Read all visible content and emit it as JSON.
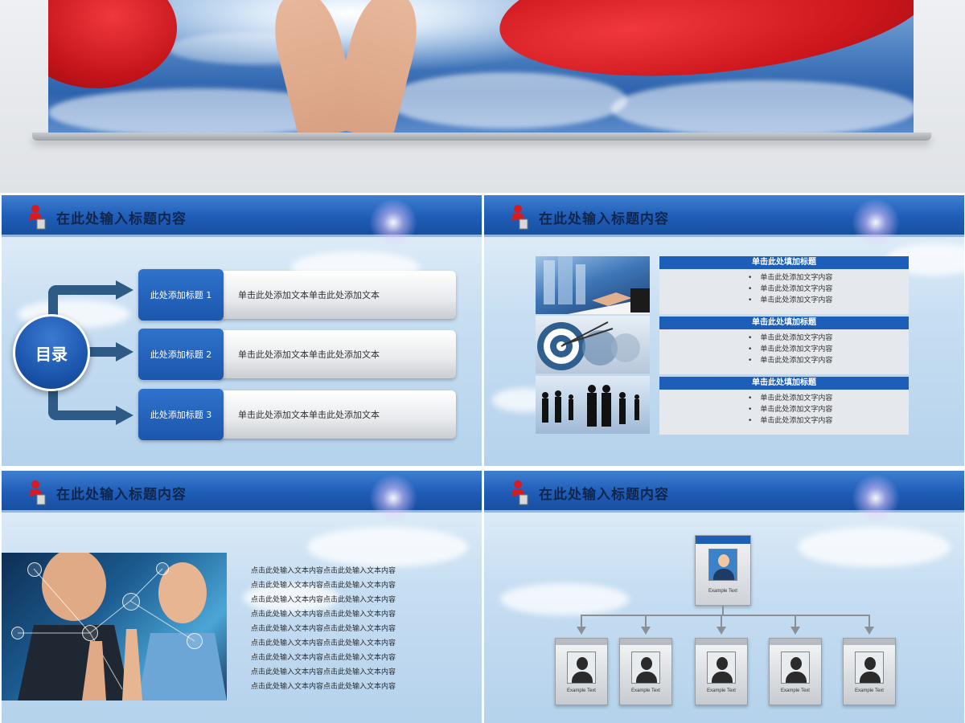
{
  "header_title": "在此处输入标题内容",
  "toc": {
    "circle_label": "目录",
    "items": [
      {
        "tab": "此处添加标题 1",
        "text": "单击此处添加文本单击此处添加文本"
      },
      {
        "tab": "此处添加标题 2",
        "text": "单击此处添加文本单击此处添加文本"
      },
      {
        "tab": "此处添加标题 3",
        "text": "单击此处添加文本单击此处添加文本"
      }
    ]
  },
  "lists": [
    {
      "heading": "单击此处填加标题",
      "bullets": [
        "单击此处添加文字内容",
        "单击此处添加文字内容",
        "单击此处添加文字内容"
      ]
    },
    {
      "heading": "单击此处填加标题",
      "bullets": [
        "单击此处添加文字内容",
        "单击此处添加文字内容",
        "单击此处添加文字内容"
      ]
    },
    {
      "heading": "单击此处填加标题",
      "bullets": [
        "单击此处添加文字内容",
        "单击此处添加文字内容",
        "单击此处添加文字内容"
      ]
    }
  ],
  "paragraph_lines": [
    "点击此处输入文本内容点击此处输入文本内容",
    "点击此处输入文本内容点击此处输入文本内容",
    "点击此处输入文本内容点击此处输入文本内容",
    "点击此处输入文本内容点击此处输入文本内容",
    "点击此处输入文本内容点击此处输入文本内容",
    "点击此处输入文本内容点击此处输入文本内容",
    "点击此处输入文本内容点击此处输入文本内容",
    "点击此处输入文本内容点击此处输入文本内容",
    "点击此处输入文本内容点击此处输入文本内容"
  ],
  "org": {
    "top_label": "Example Text",
    "cards": [
      "Example Text",
      "Example Text",
      "Example Text",
      "Example Text",
      "Example Text"
    ]
  },
  "colors": {
    "brand_blue": "#1d5fb8",
    "ribbon_red": "#d71920",
    "header_text": "#10264d"
  }
}
